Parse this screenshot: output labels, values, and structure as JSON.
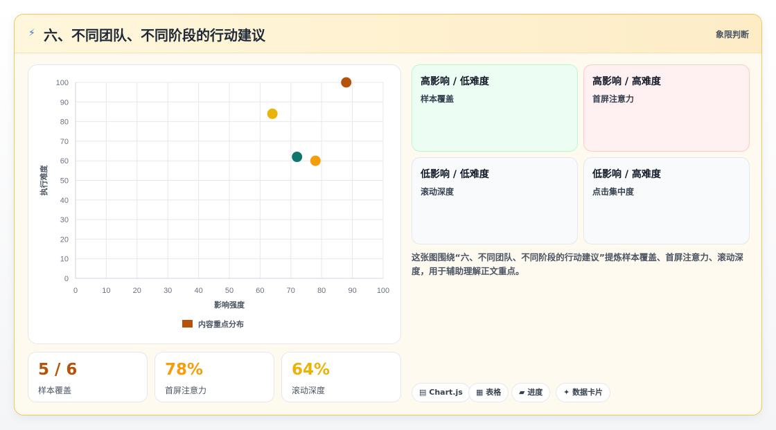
{
  "header": {
    "icon": "lightning-icon",
    "title": "六、不同团队、不同阶段的行动建议",
    "tag": "象限判断"
  },
  "chart_data": {
    "type": "scatter",
    "xlabel": "影响强度",
    "ylabel": "执行难度",
    "xlim": [
      0,
      100
    ],
    "ylim": [
      0,
      100
    ],
    "xticks": [
      0,
      10,
      20,
      30,
      40,
      50,
      60,
      70,
      80,
      90,
      100
    ],
    "yticks": [
      0,
      10,
      20,
      30,
      40,
      50,
      60,
      70,
      80,
      90,
      100
    ],
    "grid": true,
    "legend_position": "bottom",
    "series": [
      {
        "name": "内容重点分布",
        "color": "#b45309",
        "points": [
          {
            "x": 88,
            "y": 100,
            "color": "#b45309"
          },
          {
            "x": 64,
            "y": 84,
            "color": "#eab308"
          },
          {
            "x": 72,
            "y": 62,
            "color": "#0f766e"
          },
          {
            "x": 78,
            "y": 60,
            "color": "#f59e0b"
          }
        ]
      }
    ]
  },
  "kpis": [
    {
      "value": "5 / 6",
      "label": "样本覆盖",
      "color": "#b45309"
    },
    {
      "value": "78%",
      "label": "首屏注意力",
      "color": "#f59e0b"
    },
    {
      "value": "64%",
      "label": "滚动深度",
      "color": "#eab308"
    }
  ],
  "quadrants": [
    {
      "title": "高影响 / 低难度",
      "item": "样本覆盖",
      "bg": "#ecfdf3",
      "border": "#bbf7d0"
    },
    {
      "title": "高影响 / 高难度",
      "item": "首屏注意力",
      "bg": "#fff1f1",
      "border": "#fecaca"
    },
    {
      "title": "低影响 / 低难度",
      "item": "滚动深度",
      "bg": "#f8fafc",
      "border": "#e2e8f0"
    },
    {
      "title": "低影响 / 高难度",
      "item": "点击集中度",
      "bg": "#f8fafc",
      "border": "#e2e8f0"
    }
  ],
  "description": "这张图围绕“六、不同团队、不同阶段的行动建议”提炼样本覆盖、首屏注意力、滚动深度，用于辅助理解正文重点。",
  "chips": [
    {
      "icon": "chart-icon",
      "label": "Chart.js"
    },
    {
      "icon": "table-icon",
      "label": "表格"
    },
    {
      "icon": "progress-icon",
      "label": "进度"
    },
    {
      "icon": "data-card-icon",
      "label": "数据卡片"
    }
  ]
}
